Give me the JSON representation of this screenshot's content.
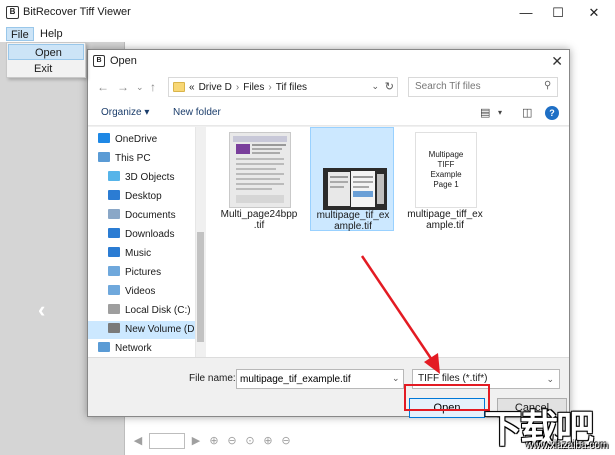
{
  "app": {
    "title": "BitRecover Tiff Viewer",
    "logo_text": "B",
    "window_controls": {
      "minimize": "—",
      "maximize": "☐",
      "close": "✕"
    }
  },
  "menubar": {
    "file": "File",
    "help": "Help"
  },
  "file_menu": {
    "open": "Open",
    "exit": "Exit"
  },
  "dialog": {
    "title": "Open",
    "logo_text": "B",
    "close_glyph": "✕",
    "breadcrumb": [
      "«",
      "Drive D",
      "Files",
      "Tif files"
    ],
    "breadcrumb_sep": "›",
    "search_placeholder": "Search Tif files",
    "organize": "Organize ▾",
    "new_folder": "New folder",
    "help_glyph": "?",
    "nav_items": [
      {
        "label": "OneDrive",
        "icon": "cloud-icon",
        "color": "#1e88e5"
      },
      {
        "label": "This PC",
        "icon": "computer-icon",
        "color": "#5a9bd5"
      },
      {
        "label": "3D Objects",
        "icon": "cube-icon",
        "color": "#56b4e9"
      },
      {
        "label": "Desktop",
        "icon": "desktop-icon",
        "color": "#2b7cd3"
      },
      {
        "label": "Documents",
        "icon": "document-icon",
        "color": "#8aa7c7"
      },
      {
        "label": "Downloads",
        "icon": "download-icon",
        "color": "#2b7cd3"
      },
      {
        "label": "Music",
        "icon": "music-icon",
        "color": "#2b7cd3"
      },
      {
        "label": "Pictures",
        "icon": "picture-icon",
        "color": "#6fa8dc"
      },
      {
        "label": "Videos",
        "icon": "video-icon",
        "color": "#6fa8dc"
      },
      {
        "label": "Local Disk (C:)",
        "icon": "disk-icon",
        "color": "#9e9e9e"
      },
      {
        "label": "New Volume (D:",
        "icon": "disk-icon",
        "color": "#7a7a7a"
      },
      {
        "label": "Network",
        "icon": "network-icon",
        "color": "#5a9bd5"
      }
    ],
    "files": [
      {
        "name": "Multi_page24bpp.tif",
        "name_line1": "Multi_page24bpp",
        "name_line2": ".tif"
      },
      {
        "name": "multipage_tif_example.tif",
        "name_line1": "multipage_tif_ex",
        "name_line2": "ample.tif"
      },
      {
        "name": "multipage_tiff_example.tif",
        "name_line1": "multipage_tiff_ex",
        "name_line2": "ample.tif",
        "thumb_lines": [
          "Multipage",
          "TIFF",
          "Example",
          "Page 1"
        ]
      }
    ],
    "file_name_label": "File name:",
    "file_name_value": "multipage_tif_example.tif",
    "file_type": "TIFF files (*.tif*)",
    "open_button": "Open",
    "cancel_button": "Cancel"
  },
  "watermark": {
    "text": "下载吧",
    "url": "www.xiazaiba.com"
  },
  "colors": {
    "highlight_red": "#e31b23",
    "selection_blue": "#cce8ff",
    "accent_blue": "#0078d7"
  }
}
